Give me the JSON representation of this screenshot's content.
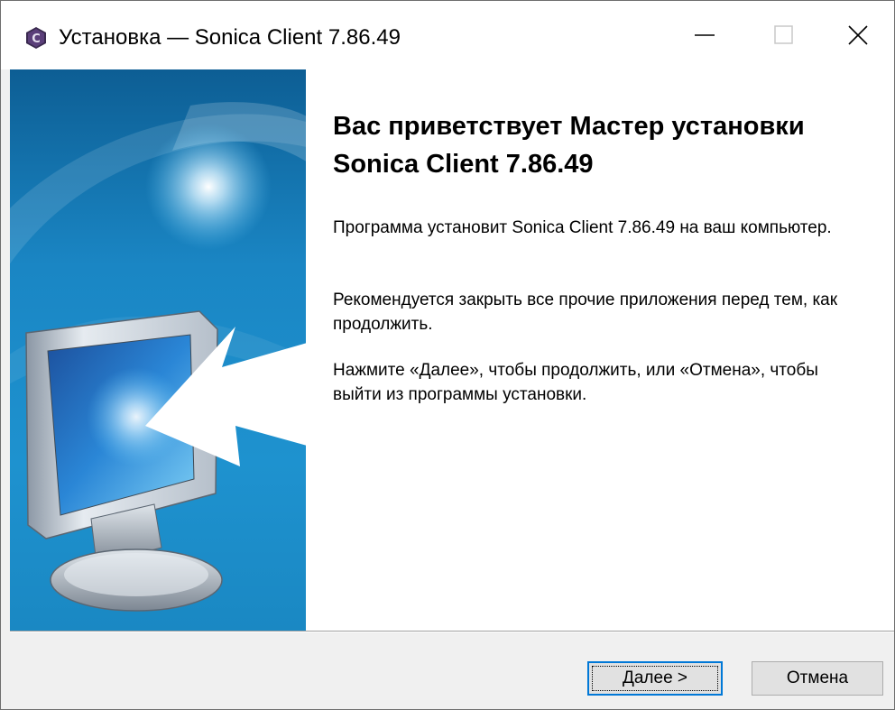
{
  "window": {
    "title": "Установка — Sonica Client 7.86.49",
    "app_icon": "sonica-app-icon",
    "icon_letter": "C",
    "accent_color": "#0078d7"
  },
  "titlebar_controls": {
    "minimize_icon": "minimize-icon",
    "maximize_icon": "maximize-icon",
    "close_icon": "close-icon"
  },
  "banner": {
    "image": "monitor-with-arrow-illustration"
  },
  "content": {
    "heading": "Вас приветствует Мастер установки Sonica Client 7.86.49",
    "paragraph1": "Программа установит Sonica Client 7.86.49 на ваш компьютер.",
    "paragraph2": "Рекомендуется закрыть все прочие приложения перед тем, как продолжить.",
    "paragraph3": "Нажмите «Далее», чтобы продолжить, или «Отмена», чтобы выйти из программы установки."
  },
  "footer": {
    "next_label": "Далее >",
    "cancel_label": "Отмена"
  }
}
